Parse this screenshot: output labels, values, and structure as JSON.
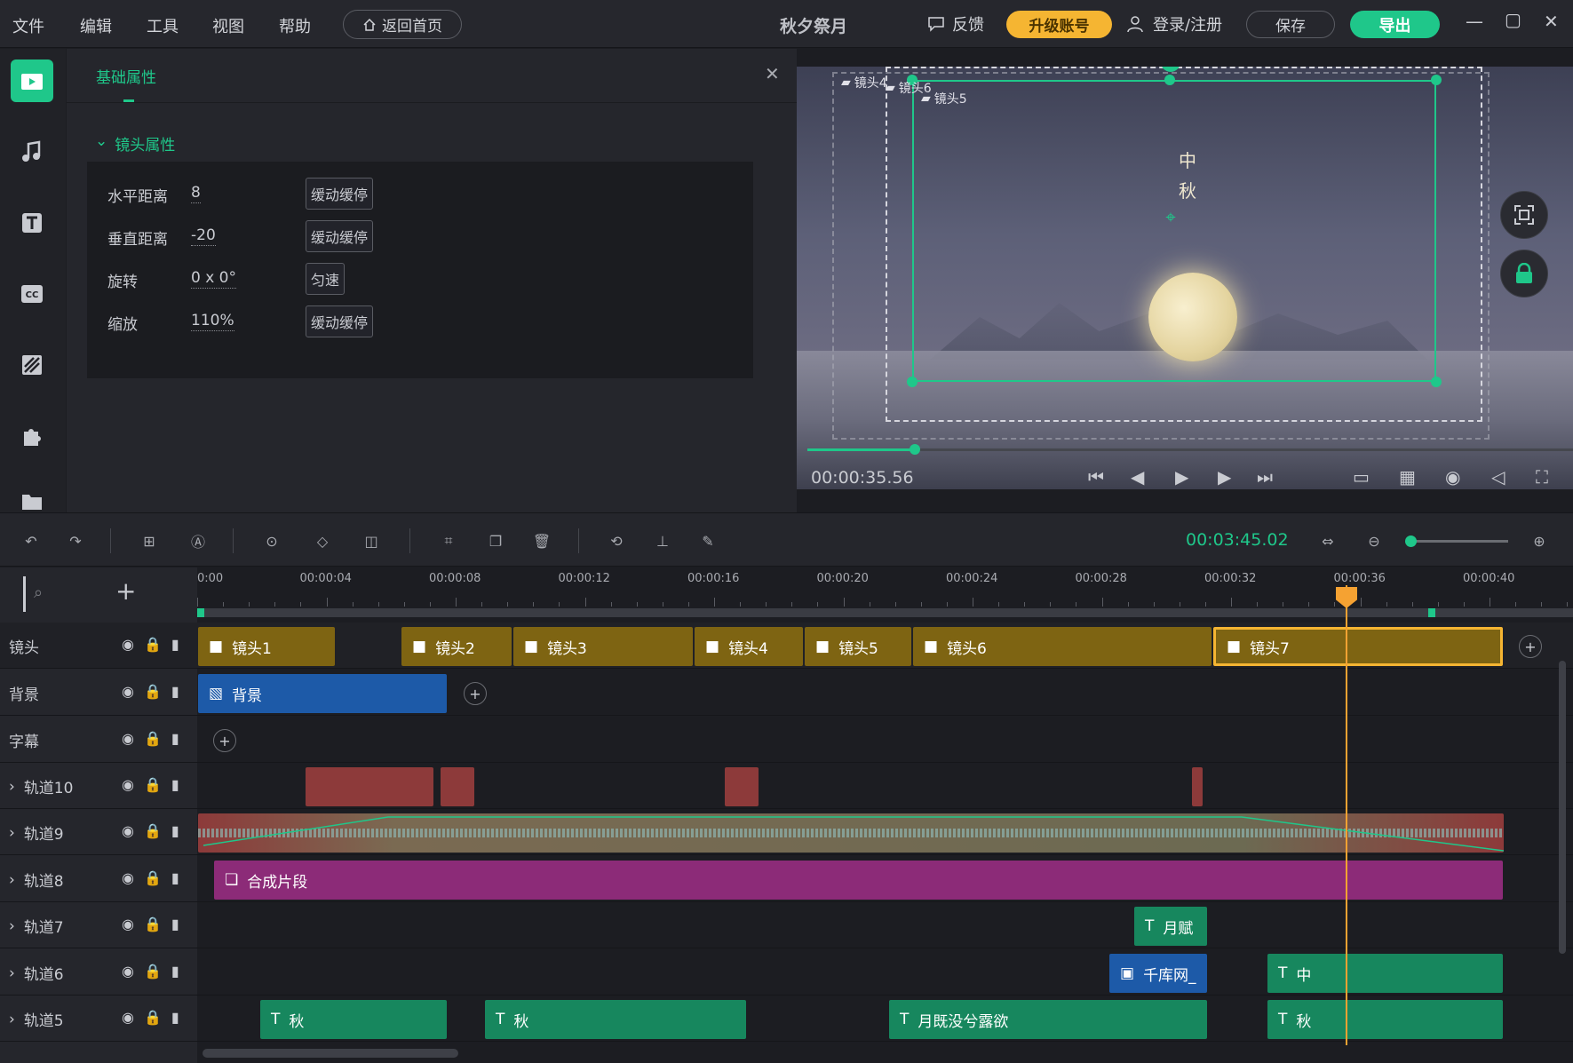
{
  "menu": {
    "items": [
      "文件",
      "编辑",
      "工具",
      "视图",
      "帮助"
    ],
    "home_label": "返回首页",
    "title": "秋夕祭月",
    "feedback_label": "反馈",
    "upgrade_label": "升级账号",
    "login_label": "登录/注册",
    "save_label": "保存",
    "export_label": "导出"
  },
  "props": {
    "tab_label": "基础属性",
    "section_title": "镜头属性",
    "rows": [
      {
        "label": "水平距离",
        "value": "8",
        "button": "缓动缓停"
      },
      {
        "label": "垂直距离",
        "value": "-20",
        "button": "缓动缓停"
      },
      {
        "label": "旋转",
        "value": "0 x 0°",
        "button": "匀速"
      },
      {
        "label": "缩放",
        "value": "110%",
        "button": "缓动缓停"
      }
    ]
  },
  "preview": {
    "current_time": "00:00:35.56",
    "progress_fraction": 0.14,
    "canvas_labels": [
      "镜头4",
      "镜头6",
      "镜头5"
    ],
    "canvas_text": [
      "中",
      "秋"
    ]
  },
  "toolbar": {
    "total_time": "00:03:45.02",
    "zoom_fraction": 0.0
  },
  "ruler": {
    "ticks": [
      "0:00",
      "00:00:04",
      "00:00:08",
      "00:00:12",
      "00:00:16",
      "00:00:20",
      "00:00:24",
      "00:00:28",
      "00:00:32",
      "00:00:36",
      "00:00:40"
    ]
  },
  "tracks": {
    "camera": {
      "name": "镜头",
      "clips": [
        "镜头1",
        "镜头2",
        "镜头3",
        "镜头4",
        "镜头5",
        "镜头6",
        "镜头7"
      ]
    },
    "background": {
      "name": "背景",
      "clip": "背景"
    },
    "subtitle": {
      "name": "字幕"
    },
    "track10": {
      "name": "轨道10"
    },
    "track9": {
      "name": "轨道9"
    },
    "track8": {
      "name": "轨道8",
      "clip": "合成片段"
    },
    "track7": {
      "name": "轨道7",
      "clip": "月赋"
    },
    "track6": {
      "name": "轨道6",
      "clips": [
        "千库网_",
        "中"
      ]
    },
    "track5": {
      "name": "轨道5",
      "clips": [
        "秋",
        "秋",
        "月既没兮露欲",
        "秋"
      ]
    }
  },
  "colors": {
    "accent": "#1fc78a",
    "upgrade": "#f5b532",
    "camera_clip": "#7e6412",
    "composite_clip": "#8c2b78",
    "text_clip": "#17875e",
    "playhead": "#f5a232"
  }
}
